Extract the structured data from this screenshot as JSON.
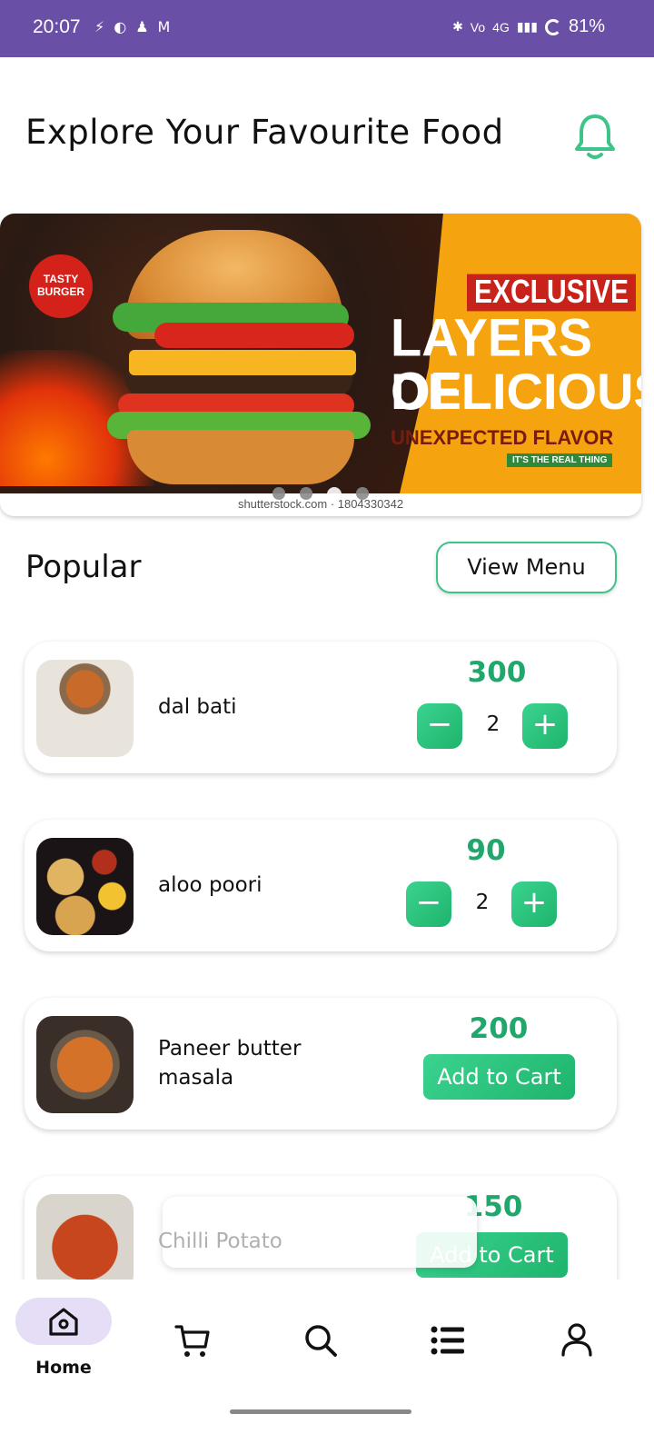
{
  "status_bar": {
    "time": "20:07",
    "battery": "81%",
    "network": "4G"
  },
  "header": {
    "title": "Explore Your Favourite Food"
  },
  "banner": {
    "badge": "TASTY BURGER",
    "headline_1": "EXCLUSIVE",
    "headline_2": "LAYERS OF",
    "headline_3": "DELICIOUS",
    "headline_4": "UNEXPECTED FLAVOR",
    "tag": "IT'S THE REAL THING",
    "credit": "shutterstock.com · 1804330342",
    "active_dot": 2
  },
  "popular": {
    "title": "Popular",
    "view_menu_label": "View Menu",
    "items": [
      {
        "name": "dal bati",
        "price": "300",
        "quantity": "2",
        "state": "stepper"
      },
      {
        "name": "aloo poori",
        "price": "90",
        "quantity": "2",
        "state": "stepper"
      },
      {
        "name": "Paneer butter masala",
        "price": "200",
        "action": "Add to Cart",
        "state": "button"
      },
      {
        "name": "Chilli Potato",
        "price": "150",
        "action": "Add to Cart",
        "state": "button"
      }
    ]
  },
  "stepper": {
    "minus": "−",
    "plus": "+"
  },
  "bottom_nav": {
    "items": [
      {
        "label": "Home",
        "icon": "home-icon",
        "active": true
      },
      {
        "label": "",
        "icon": "cart-icon"
      },
      {
        "label": "",
        "icon": "search-icon"
      },
      {
        "label": "",
        "icon": "list-icon"
      },
      {
        "label": "",
        "icon": "profile-icon"
      }
    ]
  },
  "colors": {
    "status_bar": "#6a4fa6",
    "accent_green": "#21a66b",
    "nav_active_pill": "#e6ddf6"
  }
}
